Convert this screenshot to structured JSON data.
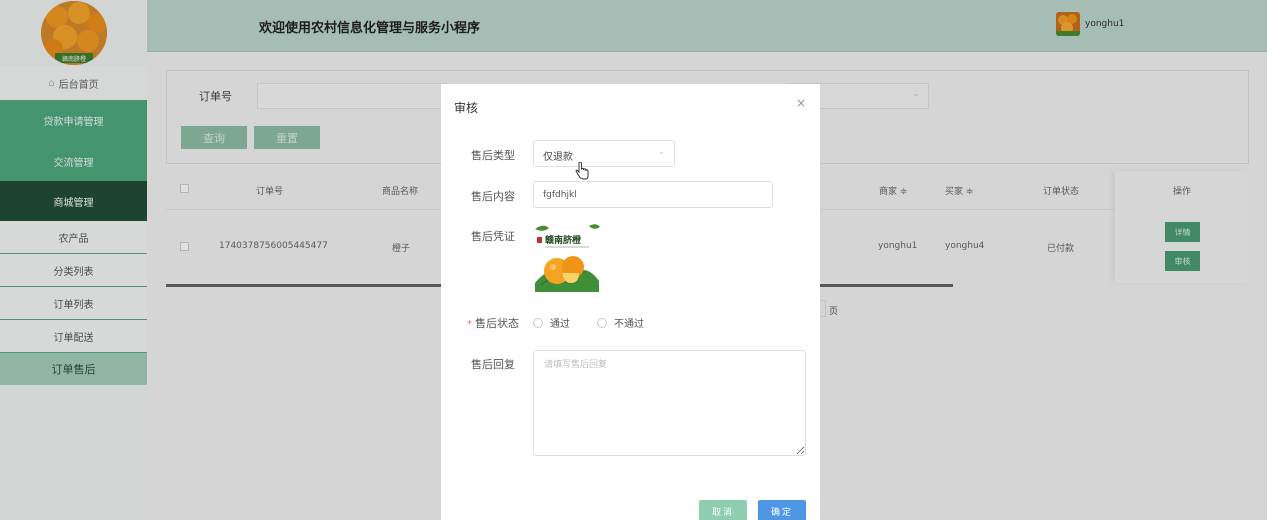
{
  "header": {
    "title": "欢迎使用农村信息化管理与服务小程序",
    "username": "yonghu1"
  },
  "sidebar": {
    "logo_text": "赣南脐橙",
    "items": [
      {
        "label": "后台首页",
        "icon": "home-icon"
      },
      {
        "label": "贷款申请管理"
      },
      {
        "label": "交流管理"
      },
      {
        "label": "商城管理"
      },
      {
        "label": "农产品"
      },
      {
        "label": "分类列表"
      },
      {
        "label": "订单列表"
      },
      {
        "label": "订单配送"
      },
      {
        "label": "订单售后"
      }
    ]
  },
  "search": {
    "order_label": "订单号",
    "query_label": "查询",
    "reset_label": "重置"
  },
  "table": {
    "headers": [
      "订单号",
      "商品名称",
      "商家 ≑",
      "买家 ≑",
      "订单状态",
      "操作"
    ],
    "row": {
      "order_no": "1740378756005445477",
      "product": "橙子",
      "merchant": "yonghu1",
      "buyer": "yonghu4",
      "status": "已付款"
    },
    "detail_label": "详情",
    "review_label": "审核",
    "page_text": "页"
  },
  "dialog": {
    "title": "审核",
    "close_glyph": "×",
    "type_label": "售后类型",
    "type_value": "仅退款",
    "content_label": "售后内容",
    "content_value": "fgfdhjkl",
    "proof_label": "售后凭证",
    "proof_caption": "赣南脐橙",
    "status_label": "售后状态",
    "status_required": "*",
    "status_options": [
      "通过",
      "不通过"
    ],
    "reply_label": "售后回复",
    "reply_placeholder": "请填写售后回复",
    "cancel_label": "取消",
    "confirm_label": "确定"
  },
  "colors": {
    "accent_green": "#4ea97e",
    "dark_green": "#224d38",
    "header_bg": "#bed8d0",
    "confirm_blue": "#4f97e5"
  }
}
